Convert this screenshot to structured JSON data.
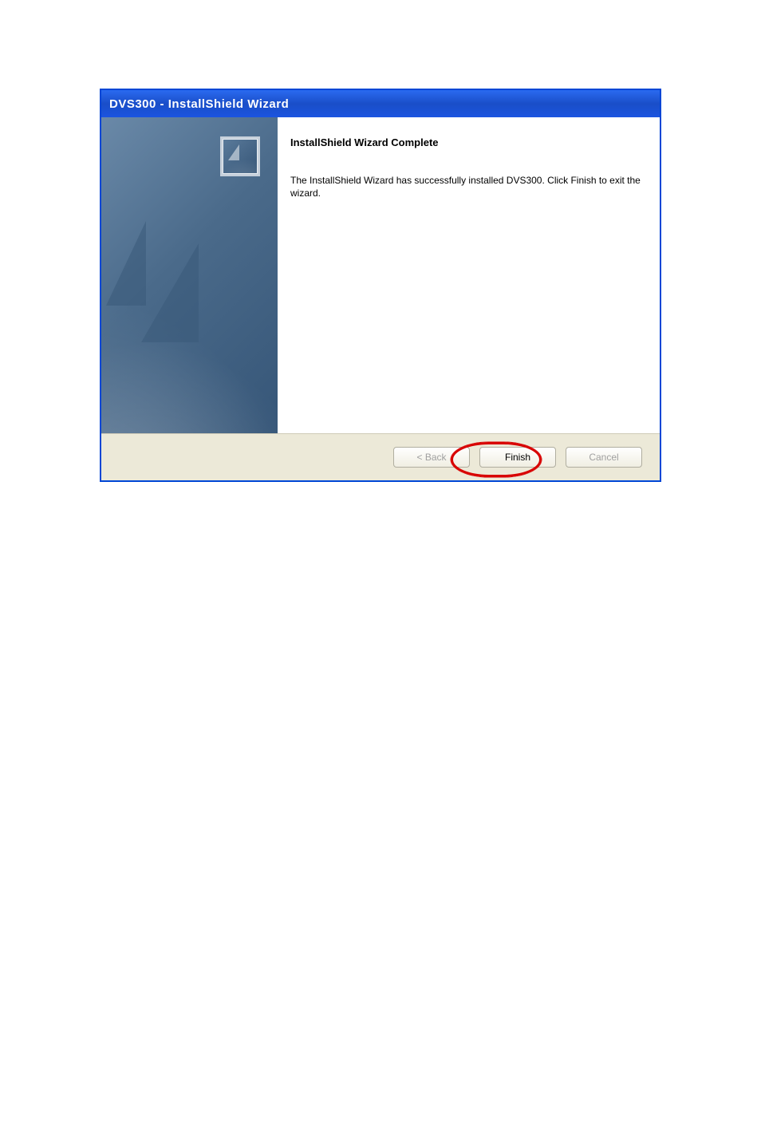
{
  "window": {
    "title": "DVS300 - InstallShield Wizard"
  },
  "content": {
    "heading": "InstallShield Wizard Complete",
    "body": "The InstallShield Wizard has successfully installed DVS300. Click Finish to exit the wizard."
  },
  "buttons": {
    "back": "< Back",
    "finish": "Finish",
    "cancel": "Cancel"
  }
}
